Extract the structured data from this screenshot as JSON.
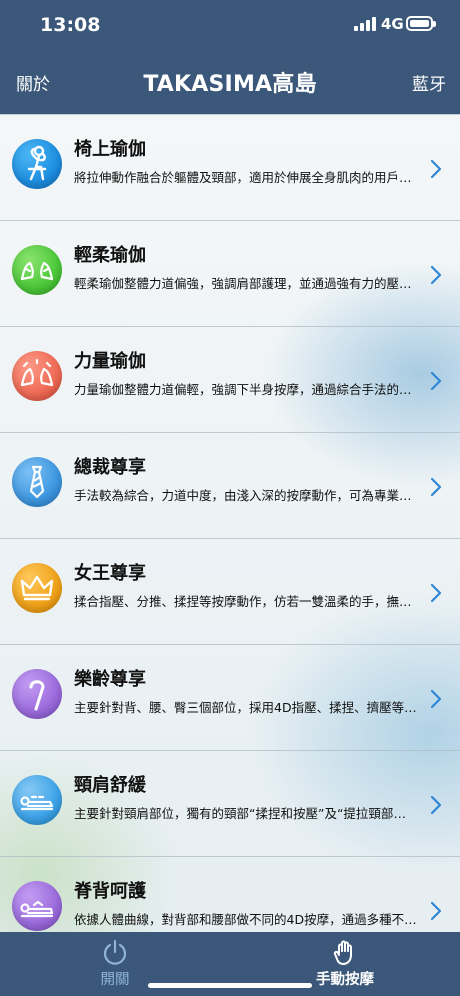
{
  "status": {
    "time": "13:08",
    "network": "4G"
  },
  "nav": {
    "left_label": "關於",
    "title": "TAKASIMA高島",
    "right_label": "藍牙"
  },
  "items": [
    {
      "title": "椅上瑜伽",
      "desc": "將拉伸動作融合於軀體及頸部，適用於伸展全身肌肉的用戶，力...",
      "icon": "chair-yoga-icon",
      "color": "#1d8fe0"
    },
    {
      "title": "輕柔瑜伽",
      "desc": "輕柔瑜伽整體力道偏強，強調肩部護理，並通過強有力的壓肩動...",
      "icon": "gentle-hands-icon",
      "color": "#4cc83a"
    },
    {
      "title": "力量瑜伽",
      "desc": "力量瑜伽整體力道偏輕，強調下半身按摩，通過綜合手法的展示...",
      "icon": "power-hands-icon",
      "color": "#ef6a55"
    },
    {
      "title": "總裁尊享",
      "desc": "手法較為綜合，力道中度，由淺入深的按摩動作，可為專業人士...",
      "icon": "necktie-icon",
      "color": "#3e97e0"
    },
    {
      "title": "女王尊享",
      "desc": "揉合指壓、分推、揉捏等按摩動作，仿若一雙溫柔的手，撫平疲...",
      "icon": "crown-icon",
      "color": "#f0a21a"
    },
    {
      "title": "樂齡尊享",
      "desc": "主要針對背、腰、臀三個部位，採用4D指壓、揉捏、擠壓等手...",
      "icon": "cane-icon",
      "color": "#9b6bdc"
    },
    {
      "title": "頸肩舒緩",
      "desc": "主要針對頸肩部位，獨有的頸部“揉捏和按壓”及“提拉頸部手法”...",
      "icon": "neck-massage-icon",
      "color": "#3da3e8"
    },
    {
      "title": "脊背呵護",
      "desc": "依據人體曲線，對背部和腰部做不同的4D按摩，通過多種不同手...",
      "icon": "back-massage-icon",
      "color": "#9b6bdc"
    }
  ],
  "tabs": [
    {
      "label": "開關",
      "icon": "power-icon"
    },
    {
      "label": "手動按摩",
      "icon": "hand-icon"
    }
  ]
}
